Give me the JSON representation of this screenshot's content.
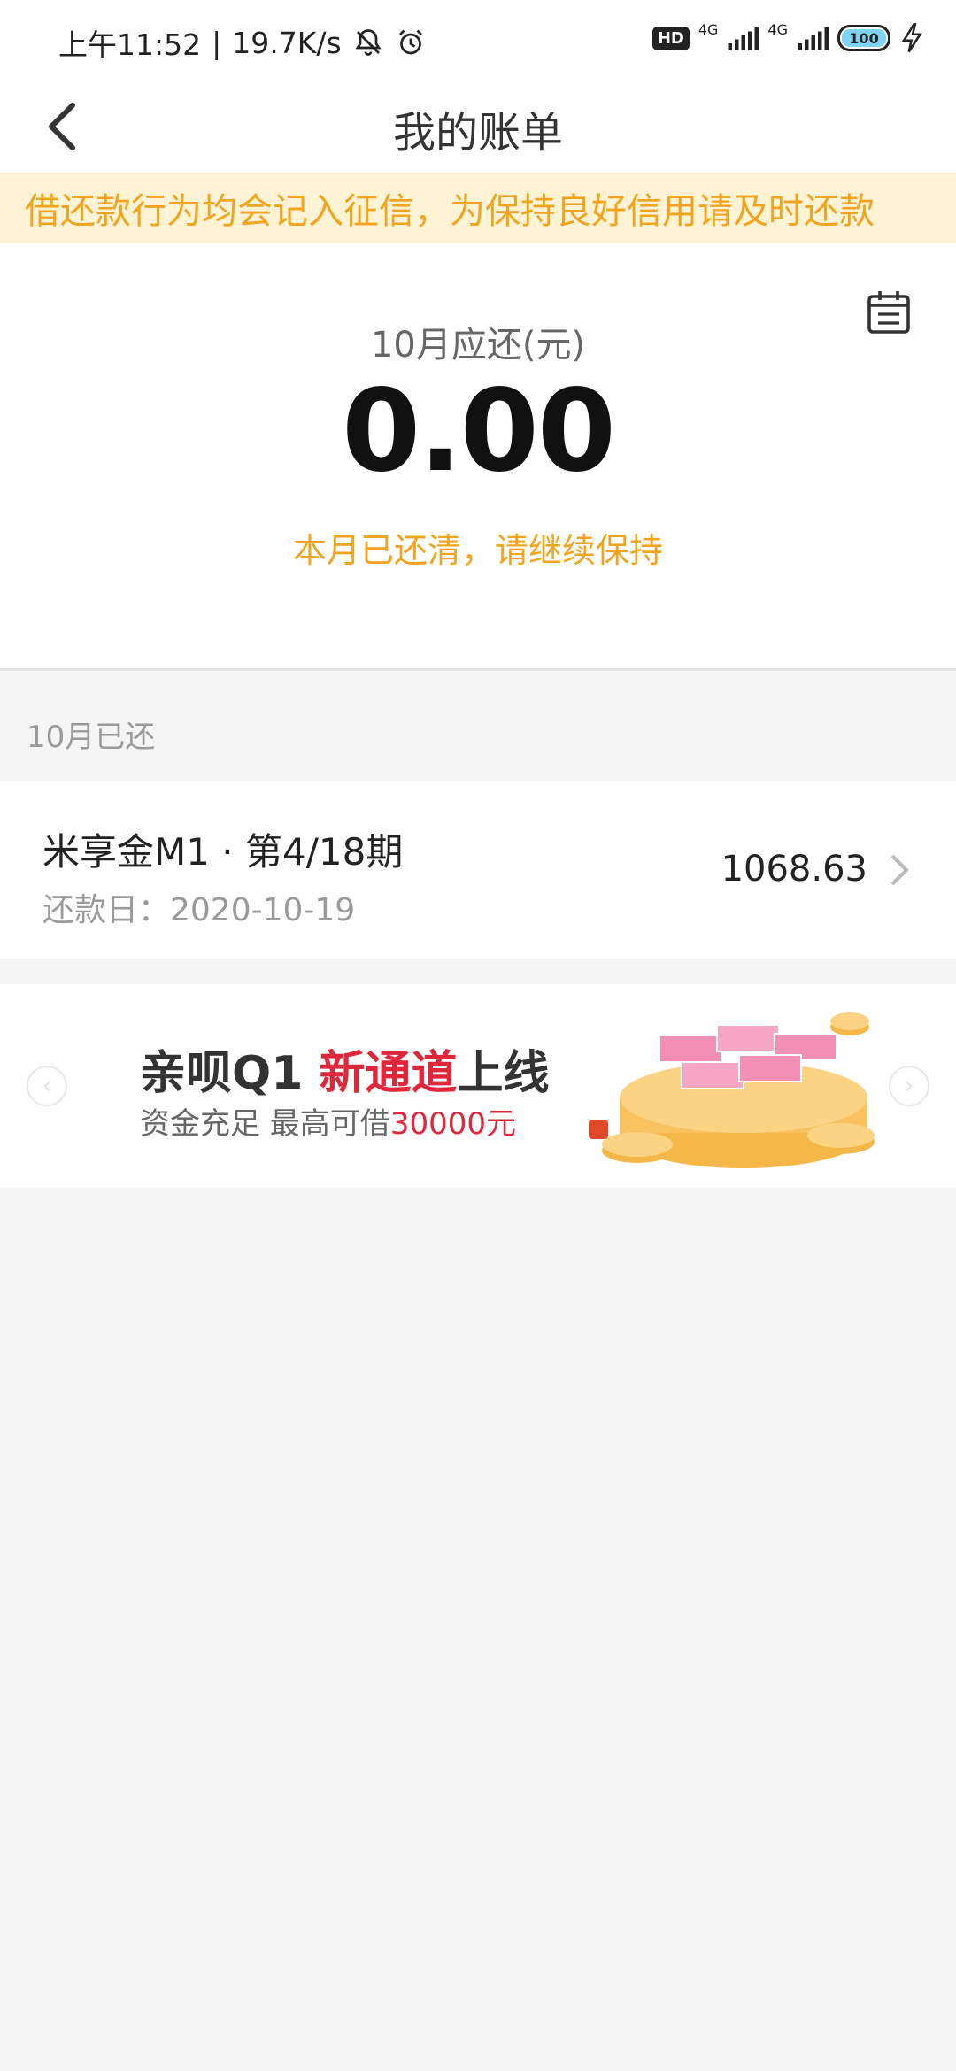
{
  "status_bar": {
    "time": "上午11:52",
    "separator": "|",
    "net_speed": "19.7K/s",
    "hd": "HD",
    "net1": "4G",
    "net2": "4G",
    "battery": "100",
    "icons": [
      "bell-off-icon",
      "alarm-icon",
      "signal-icon",
      "signal-icon",
      "battery-icon",
      "charging-icon"
    ]
  },
  "header": {
    "title": "我的账单",
    "back_icon": "back-arrow-icon"
  },
  "notice": {
    "text": "借还款行为均会记入征信，为保持良好信用请及时还款"
  },
  "summary": {
    "label": "10月应还(元)",
    "amount": "0.00",
    "status": "本月已还清，请继续保持",
    "calendar_icon": "calendar-icon"
  },
  "paid_section": {
    "label": "10月已还",
    "items": [
      {
        "name": "米享金M1 · 第4/18期",
        "date_label": "还款日：2020-10-19",
        "amount": "1068.63"
      }
    ]
  },
  "banner": {
    "title_a": "亲呗Q1 ",
    "title_b": "新通道",
    "title_c": "上线",
    "sub_a": "资金充足 最高可借",
    "sub_b": "30000元",
    "prev_icon": "chevron-left-icon",
    "next_icon": "chevron-right-icon"
  },
  "colors": {
    "accent": "#f2a41f",
    "notice_bg": "#fff3d6",
    "highlight": "#e0263b",
    "page_bg": "#f5f5f5"
  }
}
